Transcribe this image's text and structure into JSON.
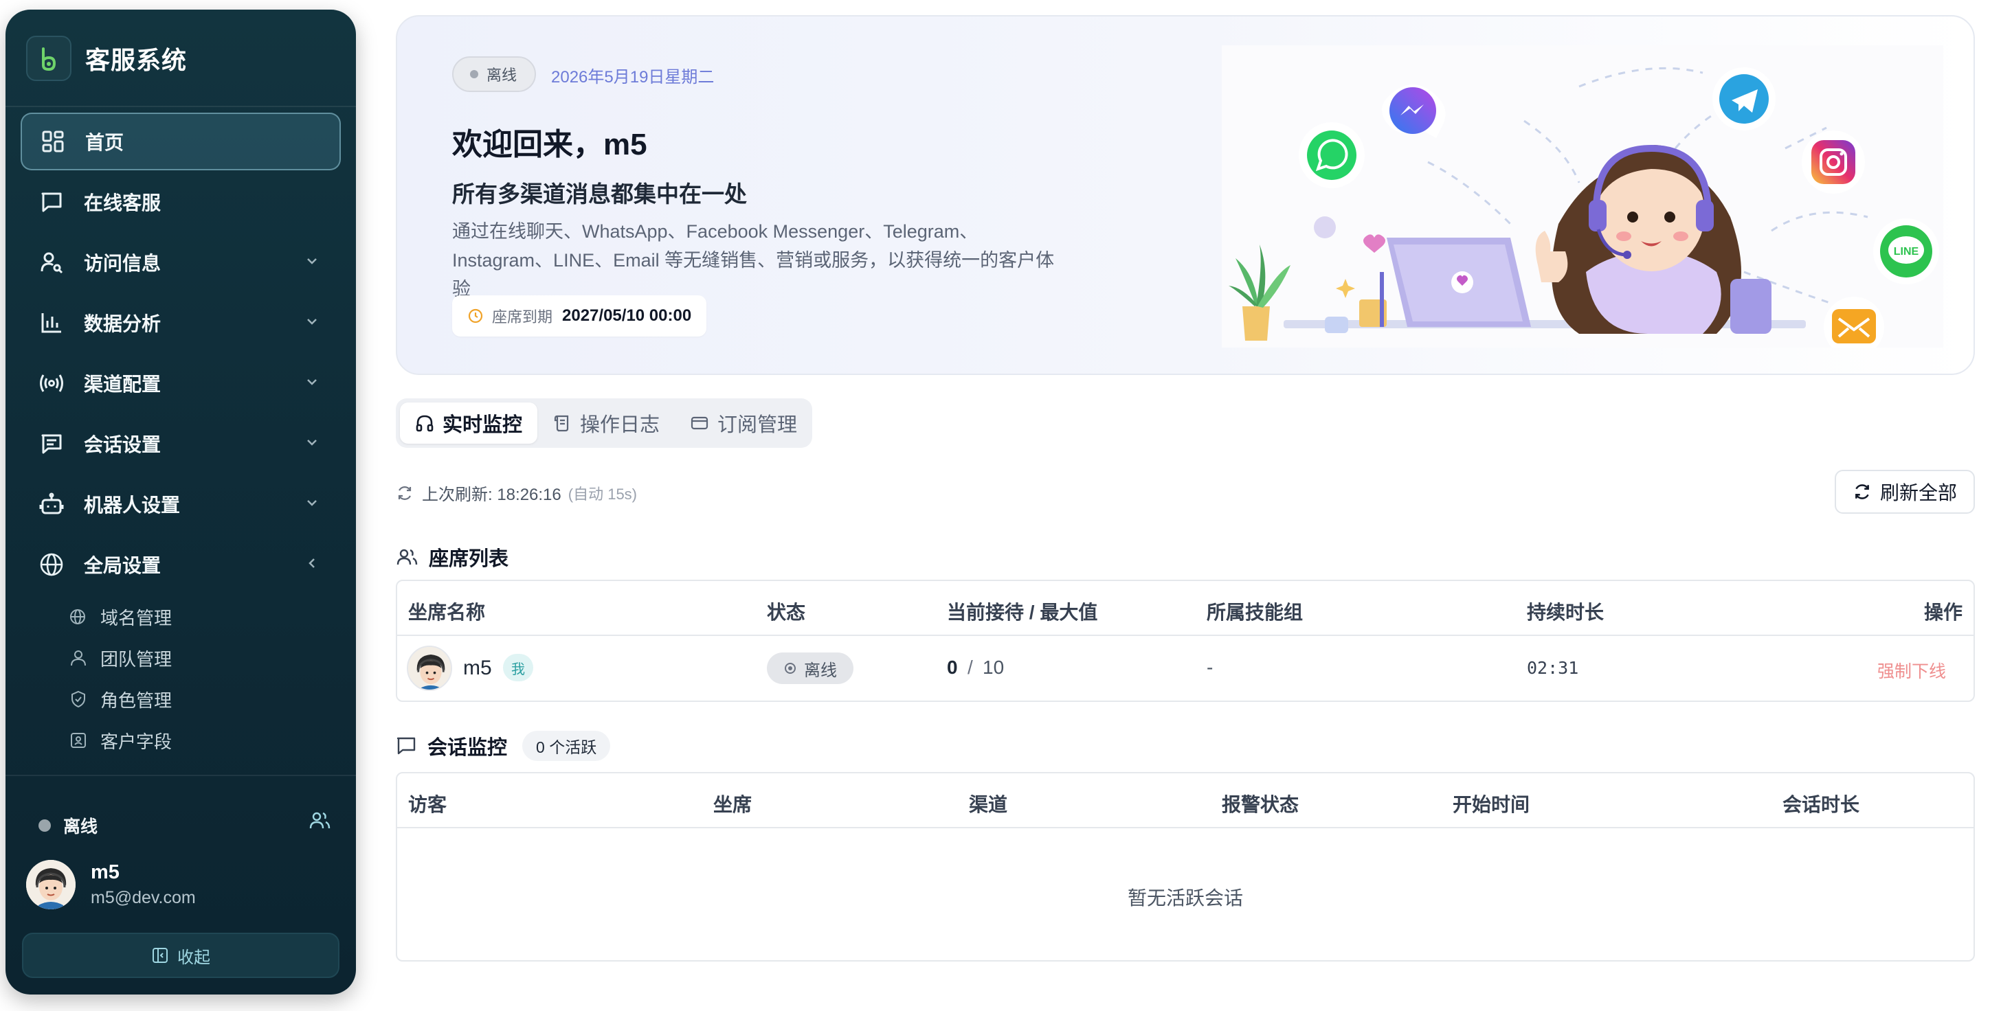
{
  "sidebar": {
    "brand": "客服系统",
    "menu": [
      {
        "label": "首页"
      },
      {
        "label": "在线客服"
      },
      {
        "label": "访问信息"
      },
      {
        "label": "数据分析"
      },
      {
        "label": "渠道配置"
      },
      {
        "label": "会话设置"
      },
      {
        "label": "机器人设置"
      },
      {
        "label": "全局设置"
      }
    ],
    "submenu": [
      {
        "label": "域名管理"
      },
      {
        "label": "团队管理"
      },
      {
        "label": "角色管理"
      },
      {
        "label": "客户字段"
      }
    ],
    "status": "离线",
    "user": {
      "name": "m5",
      "email": "m5@dev.com"
    },
    "collapse": "收起"
  },
  "hero": {
    "status": "离线",
    "date": "2026年5月19日星期二",
    "title": "欢迎回来，m5",
    "subtitle": "所有多渠道消息都集中在一处",
    "desc_line1": "通过在线聊天、WhatsApp、Facebook Messenger、Telegram、",
    "desc_line2": "Instagram、LINE、Email 等无缝销售、营销或服务，以获得统一的客户体验",
    "expiry_label": "座席到期",
    "expiry_value": "2027/05/10 00:00"
  },
  "tabs": [
    {
      "label": "实时监控"
    },
    {
      "label": "操作日志"
    },
    {
      "label": "订阅管理"
    }
  ],
  "refresh": {
    "label": "上次刷新: 18:26:16",
    "auto": "(自动 15s)",
    "button": "刷新全部"
  },
  "seats": {
    "title": "座席列表",
    "headers": [
      "坐席名称",
      "状态",
      "当前接待 / 最大值",
      "所属技能组",
      "持续时长",
      "操作"
    ],
    "rows": [
      {
        "name": "m5",
        "me": "我",
        "status": "离线",
        "current": "0",
        "sep": "/",
        "max": "10",
        "group": "-",
        "duration": "02:31",
        "action": "强制下线"
      }
    ]
  },
  "sessions": {
    "title": "会话监控",
    "count": "0 个活跃",
    "headers": [
      "访客",
      "坐席",
      "渠道",
      "报警状态",
      "开始时间",
      "会话时长"
    ],
    "empty": "暂无活跃会话"
  },
  "colors": {
    "accent": "#6d7bd8",
    "danger": "#ef8f8f",
    "sidebar": "#12343f"
  }
}
